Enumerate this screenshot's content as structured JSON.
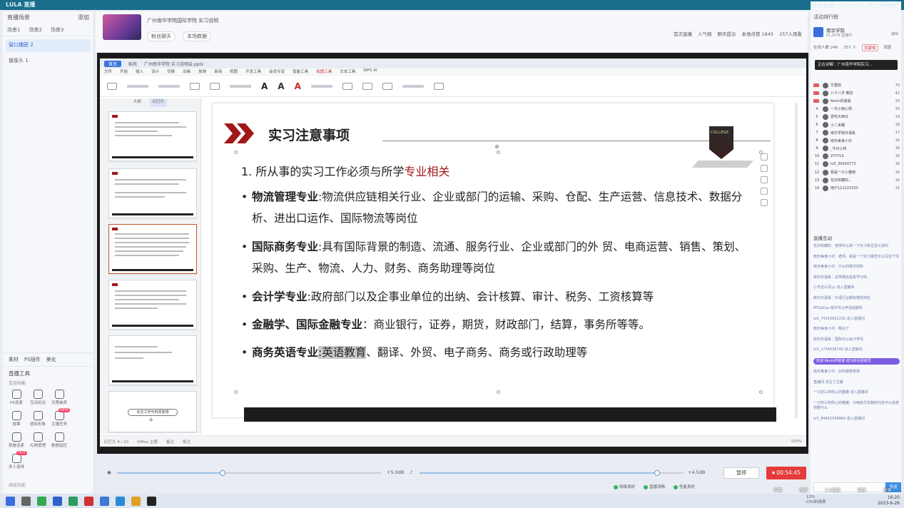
{
  "window": {
    "brand": "LULA 直播",
    "status_text": "抖音主播：你所在的公司在线网络测试",
    "controls": [
      "—",
      "□",
      "✕"
    ]
  },
  "left_panel": {
    "header": "直播场景",
    "header_action": "添加",
    "tabs": [
      "场景1",
      "场景2",
      "场景3"
    ],
    "scenes": [
      "窗口捕获 2",
      "摄像头 1"
    ],
    "bottom_tabs": [
      "素材",
      "PS插件",
      "美化"
    ],
    "tools_title": "直播工具",
    "tools_subtitle": "互动功能",
    "tools": [
      {
        "label": "PK连麦",
        "badge": ""
      },
      {
        "label": "互动玩法",
        "badge": ""
      },
      {
        "label": "无限抽奖",
        "badge": ""
      },
      {
        "label": "",
        "badge": ""
      },
      {
        "label": "投票",
        "badge": ""
      },
      {
        "label": "虚拟形象",
        "badge": ""
      },
      {
        "label": "主播任务",
        "badge": "NEW"
      },
      {
        "label": "",
        "badge": ""
      },
      {
        "label": "观看连麦",
        "badge": ""
      },
      {
        "label": "礼物管理",
        "badge": ""
      },
      {
        "label": "数据监控",
        "badge": ""
      },
      {
        "label": "",
        "badge": ""
      },
      {
        "label": "多人连线",
        "badge": "HOT"
      }
    ],
    "footer": "高级功能"
  },
  "top_info": {
    "title": "广州南华学院国际学院 实习说明",
    "buttons": [
      "粉丝聊天",
      "本场数据"
    ],
    "right_actions": [
      "首次直播",
      "人气榜",
      "聊天提示",
      "本场点赞 1845",
      "257人观看"
    ]
  },
  "wps": {
    "tabs": [
      "首页",
      "稻壳",
      "广州南华学院 实习说明会.pptx"
    ],
    "menu": [
      "文件",
      "开始",
      "插入",
      "设计",
      "切换",
      "动画",
      "放映",
      "审阅",
      "视图",
      "开发工具",
      "会员专享",
      "智能工具",
      "绘图工具",
      "文本工具",
      "WPS AI"
    ],
    "menu_active": "绘图工具",
    "thumb_tabs": [
      "大纲",
      "幻灯片"
    ],
    "thumb_last_button": "论文工作与时间安排",
    "status": [
      "幻灯片 4 / 20",
      "Office 主题",
      "备注",
      "批注"
    ],
    "zoom": "100%"
  },
  "slide": {
    "title": "实习注意事项",
    "logo_text": "COLLEGE",
    "point1_prefix": "1. 所从事的实习工作必须与所学",
    "point1_highlight": "专业相关",
    "bullets": [
      {
        "head": "物流管理专业",
        "body": ":物流供应链相关行业、企业或部门的运输、采购、仓配、生产运营、信息技术、数据分析、进出口运作、国际物流等岗位"
      },
      {
        "head": "国际商务专业",
        "body": ":具有国际背景的制造、流通、服务行业、企业或部门的外 贸、电商运营、销售、策划、采购、生产、物流、人力、财务、商务助理等岗位"
      },
      {
        "head": "会计学专业",
        "body": ":政府部门以及企事业单位的出纳、会计核算、审计、税务、工资核算等"
      },
      {
        "head": "金融学、国际金融专业",
        "body": "：商业银行，证券，期货，财政部门，结算，事务所等等。"
      }
    ],
    "last_bullet": {
      "head": "商务英语专业",
      "highlight": ":英语教育",
      "body": "、翻译、外贸、电子商务、商务或行政助理等"
    }
  },
  "controls": {
    "mic_label": "+5.0dB",
    "sys_label": "+4.5dB",
    "mic_level": 0.4,
    "sys_level": 0.9,
    "pause": "暂停",
    "rec_time": "00:54:45",
    "net": [
      "网络良好",
      "直播流畅",
      "性能良好"
    ]
  },
  "right_panel": {
    "title": "活动排行榜",
    "anchor_name": "南华学院",
    "anchor_desc": "ID 2878 直播中",
    "anchor_edit": "编辑",
    "tabs": [
      "在线人数 246",
      "257 人",
      "贡献榜",
      "回复"
    ],
    "announcement": "正在讲解：广州南华学院实习...",
    "rank": [
      {
        "n": "",
        "name": "华蓉枝",
        "score": "70"
      },
      {
        "n": "",
        "name": "八十八岁 教授",
        "score": "42"
      },
      {
        "n": "",
        "name": "Kevin的爸爸",
        "score": "20"
      },
      {
        "n": "4",
        "name": "一次小雨心情",
        "score": "20"
      },
      {
        "n": "5",
        "name": "爱吃大西瓜",
        "score": "19"
      },
      {
        "n": "6",
        "name": "小二米糊",
        "score": "18"
      },
      {
        "n": "7",
        "name": "南华学院外语系",
        "score": "17"
      },
      {
        "n": "8",
        "name": "南天美食小伙",
        "score": "16"
      },
      {
        "n": "9",
        "name": "_今日小林",
        "score": "16"
      },
      {
        "n": "10",
        "name": "ZYYYLS",
        "score": "16"
      },
      {
        "n": "11",
        "name": "lu5_36916772",
        "score": "16"
      },
      {
        "n": "12",
        "name": "我是一只小猫咪",
        "score": "16"
      },
      {
        "n": "13",
        "name": "花卉收藏的...",
        "score": "16"
      },
      {
        "n": "14",
        "name": "用户111222333",
        "score": "15"
      }
    ],
    "chat_title": "直播互动",
    "chat": [
      {
        "text": "花卉收藏的：老师可以讲一下实习单位怎么找吗",
        "pill": false
      },
      {
        "text": "南天美食小伙：老师，就是一个实习报告可以写这个吗",
        "pill": false
      },
      {
        "text": "南天美食小伙：什么时候交材料",
        "pill": false
      },
      {
        "text": "南华外语系：这学期还是有学分吗",
        "pill": false
      },
      {
        "text": "小羊这么写yy 进入直播间",
        "pill": false
      },
      {
        "text": "南华外语系：外语行业都有哪些岗位",
        "pill": false
      },
      {
        "text": "PFGdCox 南华可以申请延期吗",
        "pill": false
      },
      {
        "text": "lu5_74150912232 进入直播间",
        "pill": false
      },
      {
        "text": "南天美食小伙：明白了",
        "pill": false
      },
      {
        "text": "南华外语系：国际可以会计学吗",
        "pill": false
      },
      {
        "text": "lu5_1734536740 进入直播间",
        "pill": false
      },
      {
        "text": "欢迎 Kevin的爸爸 成为粉丝团成员",
        "pill": true
      },
      {
        "text": "南天美食小伙：好的谢谢老师",
        "pill": false
      },
      {
        "text": "直播间 关注了主播",
        "pill": false
      },
      {
        "text": "一只初三的伤心的猪猪 进入直播间",
        "pill": false
      },
      {
        "text": "一只初三的伤心的猪猪：为啥南华实践的内容可以说老师要什么",
        "pill": false
      },
      {
        "text": "lu5_84461058884 进入直播间",
        "pill": false
      }
    ],
    "send": "发送"
  },
  "taskbar": {
    "subtitle_btns": [
      "字幕",
      "画质",
      "3.0倍速",
      "倍速",
      "全屏"
    ],
    "cpu": "13%",
    "cpu_label": "CPU利用率",
    "time": "16:20",
    "date": "2023-6-26"
  },
  "colors": {
    "accent_blue": "#3a76dc",
    "slide_red": "#a01818",
    "record_red": "#e63a3a",
    "titlebar": "#1a6e8c"
  }
}
